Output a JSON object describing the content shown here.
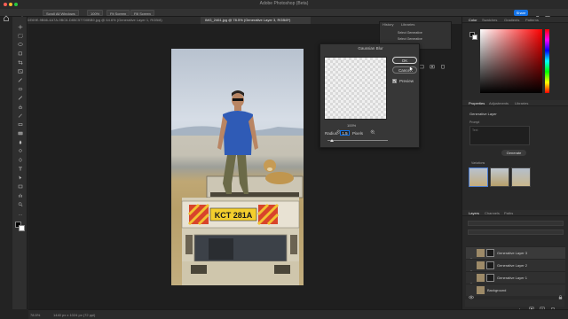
{
  "window": {
    "title": "Adobe Photoshop (Beta)"
  },
  "options_bar": {
    "scroll_all_label": "Scroll All Windows",
    "zoom_label": "100%",
    "fit_screen_label": "Fit Screen",
    "fill_screen_label": "Fill Screen",
    "share_label": "Share"
  },
  "tabs": [
    {
      "label": "A4ADE69E-9B66-4A7A-9BC6-D85C57700BB9.jpg @ 64.6% (Generative Layer 1, RGB/8)"
    },
    {
      "label": "IMG_2461.jpg @ 78.5% (Generative Layer 3, RGB/8*)"
    }
  ],
  "history_panel": {
    "tabs": [
      "History",
      "Libraries"
    ],
    "items": [
      "Select Generative",
      "Select Generative"
    ]
  },
  "dialog": {
    "title": "Gaussian Blur",
    "ok_label": "OK",
    "cancel_label": "Cancel",
    "preview_label": "Preview",
    "zoom_label": "100%",
    "radius_label": "Radius:",
    "radius_value": "1.5",
    "radius_unit": "Pixels",
    "preview_checked": true,
    "slider_fraction": 0.07
  },
  "color_panel": {
    "tabs": [
      "Color",
      "Swatches",
      "Gradients",
      "Patterns"
    ]
  },
  "properties_panel": {
    "tabs": [
      "Properties",
      "Adjustments",
      "Libraries"
    ],
    "layer_type": "Generative Layer",
    "prompt_label": "Prompt",
    "prompt_placeholder": "Text",
    "generate_label": "Generate",
    "variations_label": "Variations"
  },
  "layers_panel": {
    "tabs": [
      "Layers",
      "Channels",
      "Paths"
    ],
    "layers": [
      {
        "name": "Generative Layer 3"
      },
      {
        "name": "Generative Layer 2"
      },
      {
        "name": "Generative Layer 1"
      },
      {
        "name": "Background"
      }
    ]
  },
  "plate_text": "KCT 281A",
  "status": {
    "zoom": "78.5%",
    "doc": "1440 px x 1024 px (72 ppi)"
  },
  "colors": {
    "accent": "#1473e6",
    "panel_bg": "#292929",
    "dialog_bg": "#373737"
  }
}
